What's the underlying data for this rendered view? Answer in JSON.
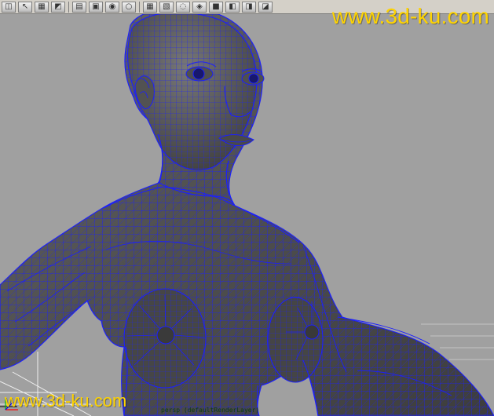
{
  "app": {
    "toolbar": {
      "buttons": [
        "viewport-icon",
        "pointer-icon",
        "texture-icon",
        "render-icon",
        "grid-icon",
        "display-icon",
        "wireframe-icon",
        "shade-icon",
        "camera-icon",
        "cube-icon",
        "light-icon",
        "lamp-icon",
        "red-cube-icon",
        "select-icon",
        "view-icon",
        "frame-icon"
      ]
    },
    "watermark": {
      "top": "www.3d-ku.com",
      "bottom": "www.3d-ku.com"
    },
    "status_label": "persp (defaultRenderLayer)",
    "colors": {
      "viewport_bg": "#a0a0a0",
      "wire": "#1b1fff",
      "mesh": "#585858",
      "toolbar": "#d4d0c8",
      "watermark": "#ffd400"
    }
  }
}
